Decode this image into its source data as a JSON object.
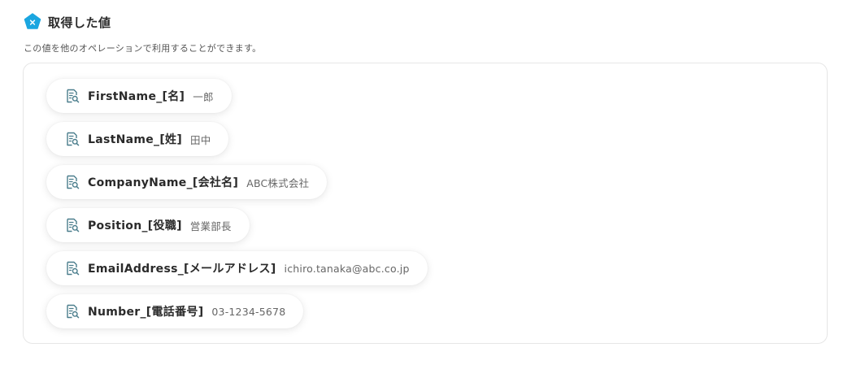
{
  "header": {
    "title": "取得した値",
    "badge_icon": "x-pentagon-icon",
    "badge_color": "#1ba6e0"
  },
  "description": "この値を他のオペレーションで利用することができます。",
  "outputs": [
    {
      "name": "FirstName_[名]",
      "value": "一郎",
      "icon": "document-search-icon"
    },
    {
      "name": "LastName_[姓]",
      "value": "田中",
      "icon": "document-search-icon"
    },
    {
      "name": "CompanyName_[会社名]",
      "value": "ABC株式会社",
      "icon": "document-search-icon"
    },
    {
      "name": "Position_[役職]",
      "value": "営業部長",
      "icon": "document-search-icon"
    },
    {
      "name": "EmailAddress_[メールアドレス]",
      "value": "ichiro.tanaka@abc.co.jp",
      "icon": "document-search-icon"
    },
    {
      "name": "Number_[電話番号]",
      "value": "03-1234-5678",
      "icon": "document-search-icon"
    }
  ],
  "colors": {
    "icon_stroke": "#4a7d8c",
    "panel_border": "#e6e6e6"
  }
}
